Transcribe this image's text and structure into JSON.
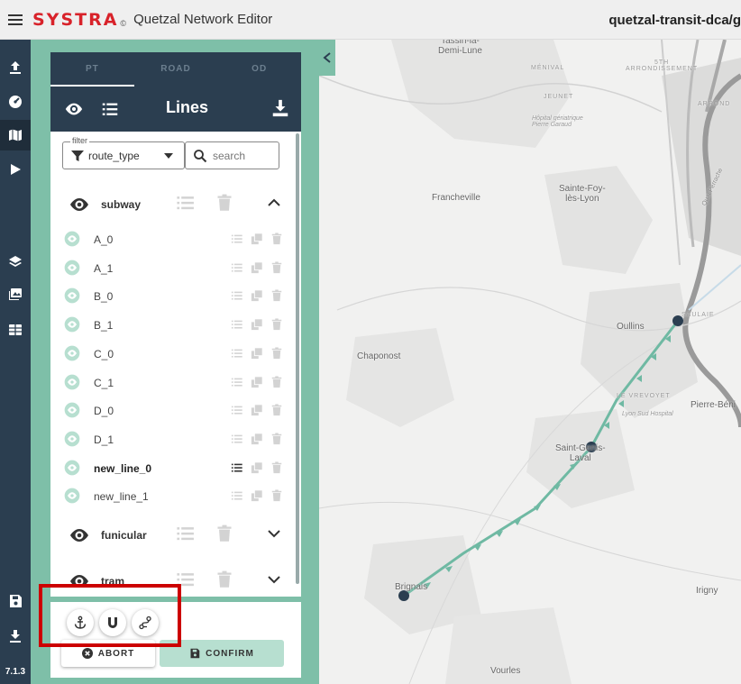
{
  "header": {
    "brand": "SYSTRA",
    "brand_mark": "©",
    "app_name": "Quetzal Network Editor",
    "project": "quetzal-transit-dca/g"
  },
  "nav": {
    "items": [
      {
        "name": "upload-icon"
      },
      {
        "name": "dashboard-icon"
      },
      {
        "name": "map-icon",
        "active": true
      },
      {
        "name": "play-icon"
      },
      {
        "name": "layers-icon"
      },
      {
        "name": "images-icon"
      },
      {
        "name": "table-icon"
      },
      {
        "name": "save-icon"
      },
      {
        "name": "download-icon"
      }
    ],
    "version": "7.1.3"
  },
  "panel": {
    "tabs": [
      "PT",
      "ROAD",
      "OD"
    ],
    "active_tab": "PT",
    "title": "Lines",
    "filter_legend": "filter",
    "filter_value": "route_type",
    "search_placeholder": "search"
  },
  "groups": [
    {
      "label": "subway",
      "expanded": true
    },
    {
      "label": "funicular",
      "expanded": false
    },
    {
      "label": "tram",
      "expanded": false
    }
  ],
  "lines": [
    {
      "label": "A_0"
    },
    {
      "label": "A_1"
    },
    {
      "label": "B_0"
    },
    {
      "label": "B_1"
    },
    {
      "label": "C_0"
    },
    {
      "label": "C_1"
    },
    {
      "label": "D_0"
    },
    {
      "label": "D_1"
    },
    {
      "label": "new_line_0",
      "selected": true
    },
    {
      "label": "new_line_1"
    }
  ],
  "actions": {
    "snap_tools": [
      "anchor-icon",
      "magnet-icon",
      "route-icon"
    ],
    "abort_label": "ABORT",
    "confirm_label": "CONFIRM"
  },
  "map": {
    "places": {
      "tassin": "Tassin-la-\nDemi-Lune",
      "menival": "MÉNIVAL",
      "arr5": "5TH\nARRONDISSEMENT",
      "jeunet": "JEUNET",
      "arrond": "ARROND",
      "hopital": "Hôpital gériatrique\nPierre Garaud",
      "francheville": "Francheville",
      "saintefoy": "Sainte-Foy-\nlès-Lyon",
      "quai": "Quai Perrache",
      "oullins": "Oullins",
      "saulaie": "SAULAIE",
      "chaponost": "Chaponost",
      "levrevoyet": "LE VREVOYET",
      "lyonsud": "Lyon Sud Hospital",
      "pierrebe": "Pierre-Béni",
      "saintgenis": "Saint-Genis-\nLaval",
      "brignais": "Brignais",
      "irigny": "Irigny",
      "vourles": "Vourles"
    },
    "line_color": "#6fb9a3",
    "stop_color": "#2b3e50"
  }
}
